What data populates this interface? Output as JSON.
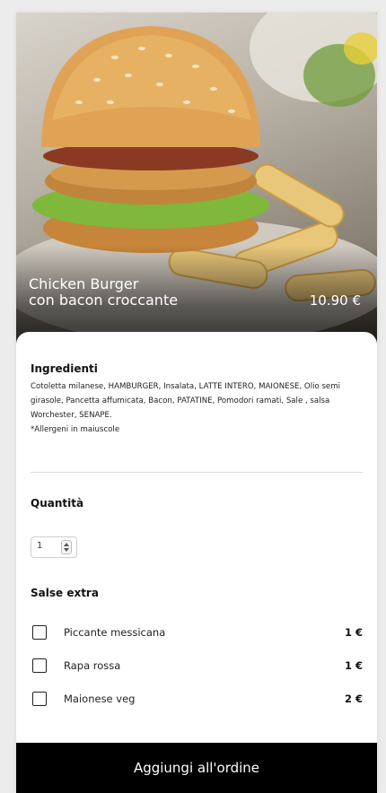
{
  "product": {
    "name_line1": "Chicken Burger",
    "name_line2": "con bacon croccante",
    "price": "10.90 €"
  },
  "ingredients": {
    "title": "Ingredienti",
    "text": "Cotoletta milanese, HAMBURGER, Insalata, LATTE INTERO, MAIONESE, Olio semi girasole, Pancetta affumicata, Bacon, PATATINE, Pomodori ramati, Sale , salsa Worchester, SENAPE.",
    "note": "*Allergeni in maiuscole"
  },
  "quantity": {
    "title": "Quantità",
    "value": "1"
  },
  "extras": {
    "title": "Salse extra",
    "items": [
      {
        "label": "Piccante messicana",
        "price": "1 €"
      },
      {
        "label": "Rapa rossa",
        "price": "1 €"
      },
      {
        "label": "Maionese veg",
        "price": "2 €"
      }
    ]
  },
  "cta": {
    "label": "Aggiungi all'ordine"
  },
  "icons": [
    "burger-photo",
    "spinner-arrows-icon",
    "checkbox"
  ],
  "colors": {
    "cta_bg": "#000000",
    "cta_text": "#ffffff",
    "sheet_bg": "#ffffff"
  }
}
